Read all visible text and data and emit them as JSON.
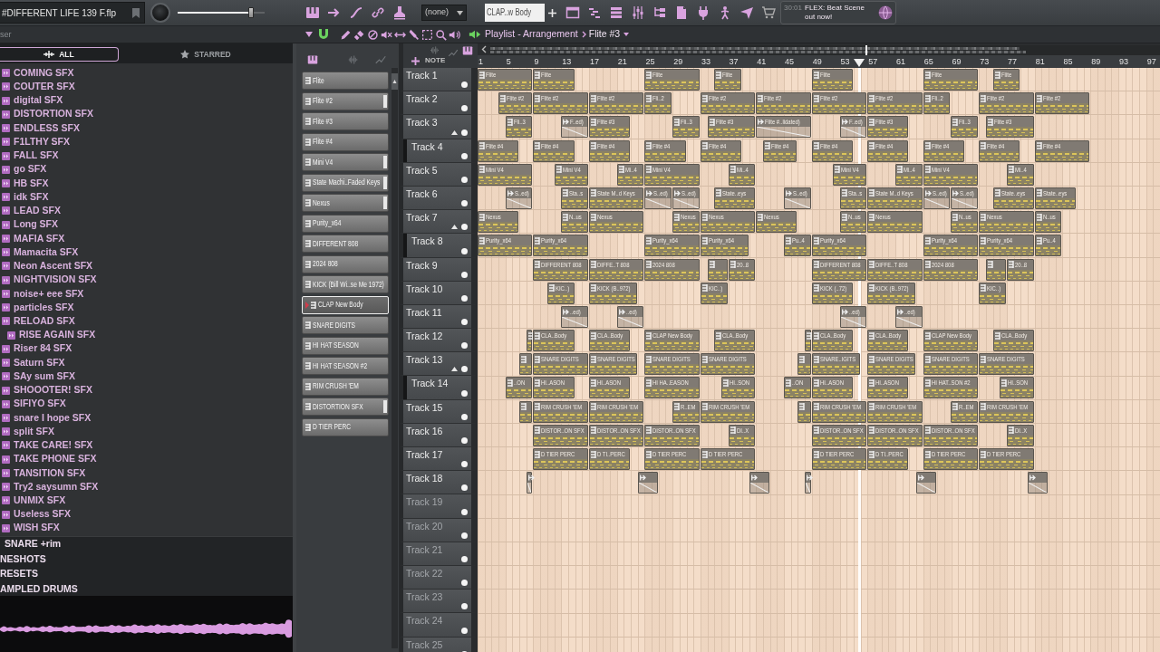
{
  "top_bar": {
    "project_title": "#DIFFERENT LIFE 139 F.flp",
    "volume_slider": {
      "level": 0.84
    },
    "pattern_selector": "(none)",
    "channel_field": "CLAP..w Body",
    "hint": {
      "time": "30:01",
      "text": "FLEX: Beat Scene out now!"
    }
  },
  "browser": {
    "title": "ser",
    "tabs": [
      {
        "label": "ALL",
        "selected": true
      },
      {
        "label": "STARRED",
        "selected": false
      }
    ],
    "items": [
      {
        "label": "COMING SFX"
      },
      {
        "label": "COUTER SFX"
      },
      {
        "label": "digital SFX"
      },
      {
        "label": "DISTORTION SFX"
      },
      {
        "label": "ENDLESS SFX"
      },
      {
        "label": "F1LTHY SFX"
      },
      {
        "label": "FALL SFX"
      },
      {
        "label": "go SFX"
      },
      {
        "label": "HB SFX"
      },
      {
        "label": "idk SFX"
      },
      {
        "label": "LEAD SFX"
      },
      {
        "label": "Long SFX"
      },
      {
        "label": "MAFIA SFX"
      },
      {
        "label": "Mamacita SFX"
      },
      {
        "label": "Neon Ascent SFX"
      },
      {
        "label": "NIGHTVISION SFX"
      },
      {
        "label": "noise+ eee SFX"
      },
      {
        "label": "particles SFX"
      },
      {
        "label": "RELOAD SFX",
        "children": [
          {
            "label": "RISE AGAIN SFX"
          }
        ]
      },
      {
        "label": "Riser 84 SFX"
      },
      {
        "label": "Saturn SFX"
      },
      {
        "label": "SAy sum SFX"
      },
      {
        "label": "SHOOOTER! SFX"
      },
      {
        "label": "SIFIYO SFX"
      },
      {
        "label": "snare I hope SFX"
      },
      {
        "label": "split SFX"
      },
      {
        "label": "TAKE CARE! SFX"
      },
      {
        "label": "TAKE PHONE SFX"
      },
      {
        "label": "TANSITION SFX"
      },
      {
        "label": "Try2 saysumn SFX"
      },
      {
        "label": "UNMIX SFX"
      },
      {
        "label": "Useless SFX"
      },
      {
        "label": "WISH SFX"
      }
    ],
    "folders": [
      {
        "label": "SNARE +rim",
        "kind": "subfolder"
      },
      {
        "label": "NESHOTS",
        "kind": "folder"
      },
      {
        "label": "RESETS",
        "kind": "folder"
      },
      {
        "label": "AMPLED DRUMS",
        "kind": "folder"
      }
    ]
  },
  "channel_rack": {
    "channels": [
      {
        "name": "Flite",
        "selected": false,
        "marked": false
      },
      {
        "name": "Flite #2",
        "selected": false,
        "marked": true
      },
      {
        "name": "Flite #3",
        "selected": false,
        "marked": false
      },
      {
        "name": "Flite #4",
        "selected": false,
        "marked": false
      },
      {
        "name": "Mini V4",
        "selected": false,
        "marked": true
      },
      {
        "name": "State Machi..Faded Keys",
        "selected": false,
        "marked": true
      },
      {
        "name": "Nexus",
        "selected": false,
        "marked": true
      },
      {
        "name": "Purity_x64",
        "selected": false,
        "marked": false
      },
      {
        "name": "DIFFERENT 808",
        "selected": false,
        "marked": false
      },
      {
        "name": "2024 808",
        "selected": false,
        "marked": false
      },
      {
        "name": "KICK (Bill Wi..se Me 1972)",
        "selected": false,
        "marked": false
      },
      {
        "name": "CLAP New Body",
        "selected": true,
        "marked": false
      },
      {
        "name": "SNARE DIGITS",
        "selected": false,
        "marked": false
      },
      {
        "name": "HI HAT SEASON",
        "selected": false,
        "marked": false
      },
      {
        "name": "HI HAT SEASON #2",
        "selected": false,
        "marked": false
      },
      {
        "name": "RIM CRUSH 'EM",
        "selected": false,
        "marked": false
      },
      {
        "name": "DISTORTION SFX",
        "selected": false,
        "marked": true
      },
      {
        "name": "D TIER PERC",
        "selected": false,
        "marked": false
      }
    ]
  },
  "playlist": {
    "title": "Playlist - Arrangement",
    "pattern": "Flite #3",
    "header_label": "NOTE",
    "ruler": [
      "1",
      "5",
      "9",
      "13",
      "17",
      "21",
      "25",
      "29",
      "33",
      "37",
      "41",
      "45",
      "49",
      "53",
      "57",
      "61",
      "65",
      "69",
      "73",
      "77",
      "81",
      "85",
      "89",
      "93",
      "97"
    ],
    "playhead": {
      "level": 0.559
    },
    "tracks": [
      {
        "name": "Track 1",
        "clips": [
          {
            "kind": "pattern",
            "name": "Flite"
          },
          {
            "kind": "pattern",
            "name": "Flite"
          },
          {
            "kind": "pattern",
            "name": "Flite"
          },
          {
            "kind": "pattern",
            "name": "Flite"
          },
          {
            "kind": "pattern",
            "name": "Flite"
          },
          {
            "kind": "pattern",
            "name": "Flite"
          },
          {
            "kind": "pattern",
            "name": "Flite"
          }
        ]
      },
      {
        "name": "Track 2",
        "clips": [
          {
            "kind": "pattern",
            "name": "Flite #2"
          },
          {
            "kind": "pattern",
            "name": "Flite #2"
          },
          {
            "kind": "pattern",
            "name": "Flite #2"
          },
          {
            "kind": "pattern",
            "name": "Fli..2"
          },
          {
            "kind": "pattern",
            "name": "Flite #2"
          },
          {
            "kind": "pattern",
            "name": "Flite #2"
          },
          {
            "kind": "pattern",
            "name": "Flite #2"
          },
          {
            "kind": "pattern",
            "name": "Flite #2"
          },
          {
            "kind": "pattern",
            "name": "Fli..2"
          },
          {
            "kind": "pattern",
            "name": "Flite #2"
          },
          {
            "kind": "pattern",
            "name": "Flite #2"
          }
        ]
      },
      {
        "name": "Track 3",
        "clips": [
          {
            "kind": "pattern",
            "name": "Fli..3"
          },
          {
            "kind": "automation",
            "name": "F..ed)"
          },
          {
            "kind": "pattern",
            "name": "Flite #3"
          },
          {
            "kind": "pattern",
            "name": "Fli..3"
          },
          {
            "kind": "pattern",
            "name": "Flite #3"
          },
          {
            "kind": "automation",
            "name": "Flite #..lidated)"
          },
          {
            "kind": "automation",
            "name": "F..ed)"
          },
          {
            "kind": "pattern",
            "name": "Flite #3"
          },
          {
            "kind": "pattern",
            "name": "Fli..3"
          },
          {
            "kind": "pattern",
            "name": "Flite #3"
          }
        ],
        "children": [
          {
            "name": "Track 4",
            "clips": [
              {
                "kind": "pattern",
                "name": "Flite #4"
              },
              {
                "kind": "pattern",
                "name": "Flite #4"
              },
              {
                "kind": "pattern",
                "name": "Flite #4"
              },
              {
                "kind": "pattern",
                "name": "Flite #4"
              },
              {
                "kind": "pattern",
                "name": "Flite #4"
              },
              {
                "kind": "pattern",
                "name": "Flite #4"
              },
              {
                "kind": "pattern",
                "name": "Flite #4"
              },
              {
                "kind": "pattern",
                "name": "Flite #4"
              },
              {
                "kind": "pattern",
                "name": "Flite #4"
              },
              {
                "kind": "pattern",
                "name": "Flite #4"
              },
              {
                "kind": "pattern",
                "name": "Flite #4"
              }
            ]
          }
        ]
      },
      {
        "name": "Track 5",
        "clips": [
          {
            "kind": "pattern",
            "name": "Mini V4"
          },
          {
            "kind": "pattern",
            "name": "Mini V4"
          },
          {
            "kind": "pattern",
            "name": "Mi..4"
          },
          {
            "kind": "pattern",
            "name": "Mini V4"
          },
          {
            "kind": "pattern",
            "name": "Mi..4"
          },
          {
            "kind": "pattern",
            "name": "Mini V4"
          },
          {
            "kind": "pattern",
            "name": "Mi..4"
          },
          {
            "kind": "pattern",
            "name": "Mini V4"
          },
          {
            "kind": "pattern",
            "name": "Mi..4"
          }
        ]
      },
      {
        "name": "Track 6",
        "clips": [
          {
            "kind": "automation",
            "name": "S..ed)"
          },
          {
            "kind": "pattern",
            "name": "Sta..s"
          },
          {
            "kind": "pattern",
            "name": "State M..d Keys"
          },
          {
            "kind": "automation",
            "name": "S..ed)"
          },
          {
            "kind": "automation",
            "name": "S..ed)"
          },
          {
            "kind": "pattern",
            "name": "State..eys"
          },
          {
            "kind": "automation",
            "name": "S..ed)"
          },
          {
            "kind": "pattern",
            "name": "Sta..s"
          },
          {
            "kind": "pattern",
            "name": "State M..d Keys"
          },
          {
            "kind": "automation",
            "name": "S..ed)"
          },
          {
            "kind": "automation",
            "name": "S..ed)"
          },
          {
            "kind": "pattern",
            "name": "State..eys"
          },
          {
            "kind": "pattern",
            "name": "State..eys"
          }
        ]
      },
      {
        "name": "Track 7",
        "clips": [
          {
            "kind": "pattern",
            "name": "Nexus"
          },
          {
            "kind": "pattern",
            "name": "N..us"
          },
          {
            "kind": "pattern",
            "name": "Nexus"
          },
          {
            "kind": "pattern",
            "name": "Nexus"
          },
          {
            "kind": "pattern",
            "name": "Nexus"
          },
          {
            "kind": "pattern",
            "name": "Nexus"
          },
          {
            "kind": "pattern",
            "name": "N..us"
          },
          {
            "kind": "pattern",
            "name": "Nexus"
          },
          {
            "kind": "pattern",
            "name": "N..us"
          },
          {
            "kind": "pattern",
            "name": "Nexus"
          },
          {
            "kind": "pattern",
            "name": "N..us"
          }
        ],
        "children": [
          {
            "name": "Track 8",
            "clips": [
              {
                "kind": "pattern",
                "name": "Purity_x64"
              },
              {
                "kind": "pattern",
                "name": "Purity_x64"
              },
              {
                "kind": "pattern",
                "name": "Purity_x64"
              },
              {
                "kind": "pattern",
                "name": "Purity_x64"
              },
              {
                "kind": "pattern",
                "name": "Pu..4"
              },
              {
                "kind": "pattern",
                "name": "Purity_x64"
              },
              {
                "kind": "pattern",
                "name": "Purity_x64"
              },
              {
                "kind": "pattern",
                "name": "Purity_x64"
              },
              {
                "kind": "pattern",
                "name": "Pu..4"
              }
            ]
          }
        ]
      },
      {
        "name": "Track 9",
        "clips": [
          {
            "kind": "pattern",
            "name": "DIFFERENT 808"
          },
          {
            "kind": "pattern",
            "name": "DIFFE..T 808"
          },
          {
            "kind": "pattern",
            "name": "2024 808"
          },
          {
            "kind": "pattern"
          },
          {
            "kind": "pattern",
            "name": "20..8"
          },
          {
            "kind": "pattern",
            "name": "DIFFERENT 808"
          },
          {
            "kind": "pattern",
            "name": "DIFFE..T 808"
          },
          {
            "kind": "pattern",
            "name": "2024 808"
          },
          {
            "kind": "pattern"
          },
          {
            "kind": "pattern",
            "name": "20..8"
          }
        ]
      },
      {
        "name": "Track 10",
        "clips": [
          {
            "kind": "pattern",
            "name": "KIC..)"
          },
          {
            "kind": "pattern",
            "name": "KICK (B..972)"
          },
          {
            "kind": "pattern",
            "name": "KIC..)"
          },
          {
            "kind": "pattern",
            "name": "KICK (..72)"
          },
          {
            "kind": "pattern",
            "name": "KICK (B..972)"
          },
          {
            "kind": "pattern",
            "name": "KIC..)"
          }
        ]
      },
      {
        "name": "Track 11",
        "clips": [
          {
            "kind": "automation",
            "name": "..ed)"
          },
          {
            "kind": "automation",
            "name": "..ed)"
          },
          {
            "kind": "automation",
            "name": "..ed)"
          },
          {
            "kind": "automation",
            "name": "..ed)"
          }
        ]
      },
      {
        "name": "Track 12",
        "clips": [
          {
            "kind": "pattern"
          },
          {
            "kind": "pattern",
            "name": "CLA..Body"
          },
          {
            "kind": "pattern",
            "name": "CLA..Body"
          },
          {
            "kind": "pattern",
            "name": "CLAP New Body"
          },
          {
            "kind": "pattern",
            "name": "CLA..Body"
          },
          {
            "kind": "pattern"
          },
          {
            "kind": "pattern",
            "name": "CLA..Body"
          },
          {
            "kind": "pattern",
            "name": "CLA..Body"
          },
          {
            "kind": "pattern",
            "name": "CLAP New Body"
          },
          {
            "kind": "pattern",
            "name": "CLA..Body"
          }
        ]
      },
      {
        "name": "Track 13",
        "clips": [
          {
            "kind": "pattern"
          },
          {
            "kind": "pattern",
            "name": "SNARE DIGITS"
          },
          {
            "kind": "pattern",
            "name": "SNARE DIGITS"
          },
          {
            "kind": "pattern",
            "name": "SNARE DIGITS"
          },
          {
            "kind": "pattern",
            "name": "SNARE DIGITS"
          },
          {
            "kind": "pattern"
          },
          {
            "kind": "pattern",
            "name": "SNARE..IGITS"
          },
          {
            "kind": "pattern",
            "name": "SNARE DIGITS"
          },
          {
            "kind": "pattern",
            "name": "SNARE DIGITS"
          },
          {
            "kind": "pattern",
            "name": "SNARE DIGITS"
          }
        ],
        "children": [
          {
            "name": "Track 14",
            "clips": [
              {
                "kind": "pattern",
                "name": "..ON"
              },
              {
                "kind": "pattern",
                "name": "HI..ASON"
              },
              {
                "kind": "pattern",
                "name": "HI..ASON"
              },
              {
                "kind": "pattern",
                "name": "HI HA..EASON"
              },
              {
                "kind": "pattern",
                "name": "HI..SON"
              },
              {
                "kind": "pattern",
                "name": "..ON"
              },
              {
                "kind": "pattern",
                "name": "HI..ASON"
              },
              {
                "kind": "pattern",
                "name": "HI..ASON"
              },
              {
                "kind": "pattern",
                "name": "HI HAT..SON #2"
              },
              {
                "kind": "pattern",
                "name": "HI..SON"
              }
            ]
          }
        ]
      },
      {
        "name": "Track 15",
        "clips": [
          {
            "kind": "pattern"
          },
          {
            "kind": "pattern",
            "name": "RIM CRUSH 'EM"
          },
          {
            "kind": "pattern",
            "name": "RIM CRUSH 'EM"
          },
          {
            "kind": "pattern",
            "name": "R..EM"
          },
          {
            "kind": "pattern",
            "name": "RIM CRUSH 'EM"
          },
          {
            "kind": "pattern"
          },
          {
            "kind": "pattern",
            "name": "RIM CRUSH 'EM"
          },
          {
            "kind": "pattern",
            "name": "RIM CRUSH 'EM"
          },
          {
            "kind": "pattern",
            "name": "R..EM"
          },
          {
            "kind": "pattern",
            "name": "RIM CRUSH 'EM"
          }
        ]
      },
      {
        "name": "Track 16",
        "clips": [
          {
            "kind": "pattern",
            "name": "DISTOR..ON SFX"
          },
          {
            "kind": "pattern",
            "name": "DISTOR..ON SFX"
          },
          {
            "kind": "pattern",
            "name": "DISTOR..ON SFX"
          },
          {
            "kind": "pattern",
            "name": "DI..X"
          },
          {
            "kind": "pattern",
            "name": "DISTOR..ON SFX"
          },
          {
            "kind": "pattern",
            "name": "DISTOR..ON SFX"
          },
          {
            "kind": "pattern",
            "name": "DISTOR..ON SFX"
          },
          {
            "kind": "pattern",
            "name": "DI..X"
          }
        ]
      },
      {
        "name": "Track 17",
        "clips": [
          {
            "kind": "pattern",
            "name": "D TIER PERC"
          },
          {
            "kind": "pattern",
            "name": "D TI..PERC"
          },
          {
            "kind": "pattern",
            "name": "D TIER PERC"
          },
          {
            "kind": "pattern",
            "name": "D TIER PERC"
          },
          {
            "kind": "pattern",
            "name": "D TIER PERC"
          },
          {
            "kind": "pattern",
            "name": "D TI..PERC"
          },
          {
            "kind": "pattern",
            "name": "D TIER PERC"
          },
          {
            "kind": "pattern",
            "name": "D TIER PERC"
          }
        ]
      },
      {
        "name": "Track 18",
        "clips": [
          {
            "kind": "automation"
          },
          {
            "kind": "automation"
          },
          {
            "kind": "automation"
          },
          {
            "kind": "automation"
          },
          {
            "kind": "automation"
          },
          {
            "kind": "automation"
          }
        ]
      },
      {
        "name": "Track 19"
      },
      {
        "name": "Track 20"
      },
      {
        "name": "Track 21"
      },
      {
        "name": "Track 22"
      },
      {
        "name": "Track 23"
      },
      {
        "name": "Track 24"
      },
      {
        "name": "Track 25"
      }
    ]
  }
}
